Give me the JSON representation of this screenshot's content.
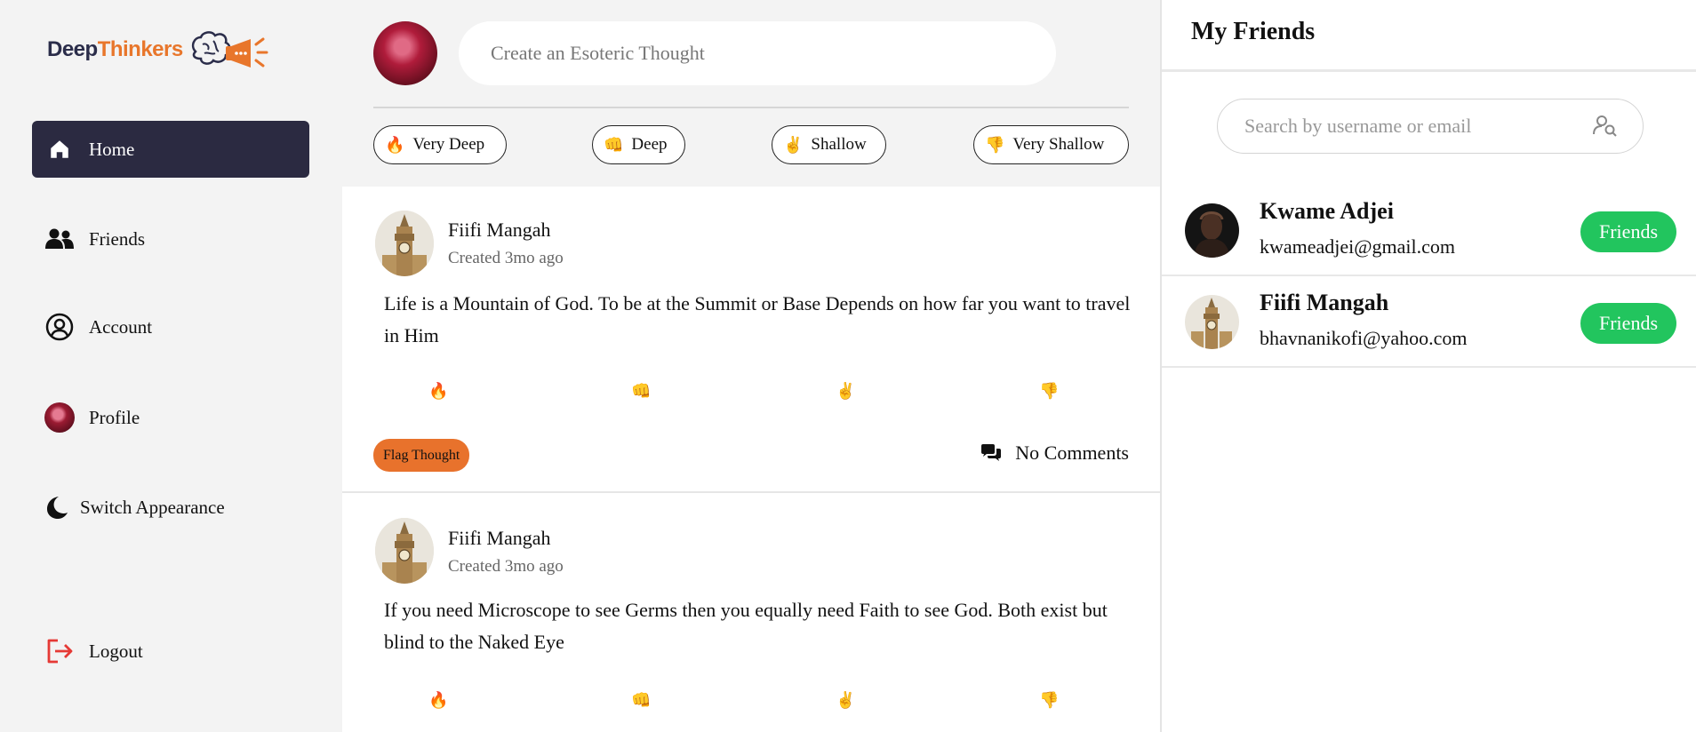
{
  "brand": {
    "part1": "Deep",
    "part2": "Thinkers"
  },
  "sidebar": {
    "items": [
      {
        "label": "Home",
        "icon": "home-icon",
        "active": true
      },
      {
        "label": "Friends",
        "icon": "users-icon"
      },
      {
        "label": "Account",
        "icon": "user-circle-icon"
      },
      {
        "label": "Profile",
        "icon": "avatar"
      },
      {
        "label": "Switch Appearance",
        "icon": "moon-icon"
      }
    ],
    "logout": {
      "label": "Logout",
      "icon": "logout-icon"
    }
  },
  "composer": {
    "placeholder": "Create an Esoteric Thought"
  },
  "filters": [
    {
      "emoji": "🔥",
      "label": "Very Deep"
    },
    {
      "emoji": "👊",
      "label": "Deep"
    },
    {
      "emoji": "✌️",
      "label": "Shallow"
    },
    {
      "emoji": "👎",
      "label": "Very Shallow"
    }
  ],
  "posts": [
    {
      "author": "Fiifi Mangah",
      "time": "Created 3mo ago",
      "body": "Life is a Mountain of God. To be at the Summit or Base Depends on how far you want to travel in Him",
      "reactions": [
        "🔥",
        "👊",
        "✌️",
        "👎"
      ],
      "flag_label": "Flag Thought",
      "comments_label": "No Comments"
    },
    {
      "author": "Fiifi Mangah",
      "time": "Created 3mo ago",
      "body": "If you need Microscope to see Germs then you equally need Faith to see God. Both exist but blind to the Naked Eye",
      "reactions": [
        "🔥",
        "👊",
        "✌️",
        "👎"
      ]
    }
  ],
  "friends_panel": {
    "title": "My Friends",
    "search_placeholder": "Search by username or email",
    "friends": [
      {
        "name": "Kwame Adjei",
        "email": "kwameadjei@gmail.com",
        "status": "Friends"
      },
      {
        "name": "Fiifi Mangah",
        "email": "bhavnanikofi@yahoo.com",
        "status": "Friends"
      }
    ]
  },
  "colors": {
    "accent_dark": "#2b2a41",
    "brand_orange": "#e8762b",
    "flag_orange": "#e8722c",
    "friends_green": "#22c55e",
    "logout_red": "#e53935"
  }
}
